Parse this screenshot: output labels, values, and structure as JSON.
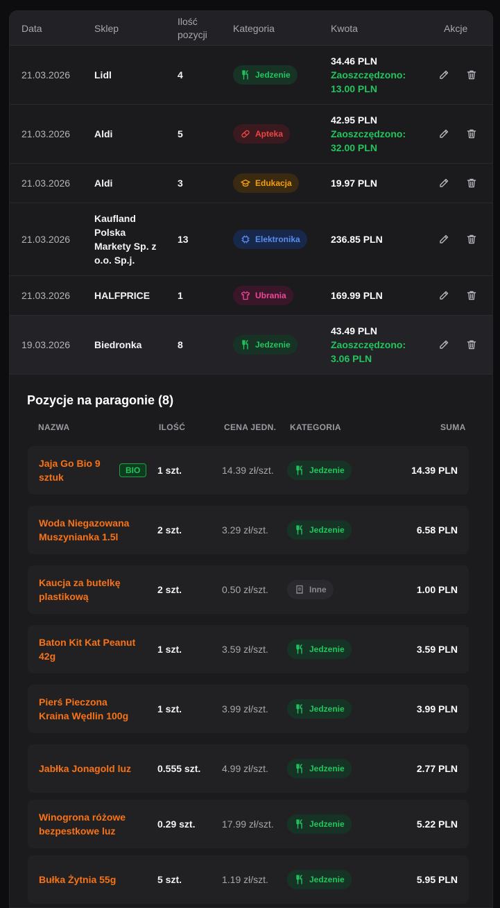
{
  "table": {
    "headers": {
      "date": "Data",
      "shop": "Sklep",
      "count_line1": "Ilość",
      "count_line2": "pozycji",
      "category": "Kategoria",
      "amount": "Kwota",
      "actions": "Akcje"
    },
    "rows": [
      {
        "date": "21.03.2026",
        "shop": "Lidl",
        "count": "4",
        "category": "Jedzenie",
        "amount": "34.46 PLN",
        "saved_label": "Zaoszczędzono:",
        "saved_value": "13.00 PLN"
      },
      {
        "date": "21.03.2026",
        "shop": "Aldi",
        "count": "5",
        "category": "Apteka",
        "amount": "42.95 PLN",
        "saved_label": "Zaoszczędzono:",
        "saved_value": "32.00 PLN"
      },
      {
        "date": "21.03.2026",
        "shop": "Aldi",
        "count": "3",
        "category": "Edukacja",
        "amount": "19.97 PLN"
      },
      {
        "date": "21.03.2026",
        "shop": "Kaufland Polska Markety Sp. z o.o. Sp.j.",
        "count": "13",
        "category": "Elektronika",
        "amount": "236.85 PLN"
      },
      {
        "date": "21.03.2026",
        "shop": "HALFPRICE",
        "count": "1",
        "category": "Ubrania",
        "amount": "169.99 PLN"
      },
      {
        "date": "19.03.2026",
        "shop": "Biedronka",
        "count": "8",
        "category": "Jedzenie",
        "amount": "43.49 PLN",
        "saved_label": "Zaoszczędzono:",
        "saved_value": "3.06 PLN"
      }
    ]
  },
  "detail": {
    "title": "Pozycje na paragonie (8)",
    "headers": {
      "name": "NAZWA",
      "qty": "ILOŚĆ",
      "unit_price": "CENA JEDN.",
      "category": "KATEGORIA",
      "sum": "SUMA"
    },
    "bio_label": "BIO",
    "items": [
      {
        "name": "Jaja Go Bio 9 sztuk",
        "qty": "1 szt.",
        "unit_price": "14.39 zł/szt.",
        "category": "Jedzenie",
        "sum": "14.39 PLN"
      },
      {
        "name": "Woda Niegazowana Muszynianka 1.5l",
        "qty": "2 szt.",
        "unit_price": "3.29 zł/szt.",
        "category": "Jedzenie",
        "sum": "6.58 PLN"
      },
      {
        "name": "Kaucja za butelkę plastikową",
        "qty": "2 szt.",
        "unit_price": "0.50 zł/szt.",
        "category": "Inne",
        "sum": "1.00 PLN"
      },
      {
        "name": "Baton Kit Kat Peanut 42g",
        "qty": "1 szt.",
        "unit_price": "3.59 zł/szt.",
        "category": "Jedzenie",
        "sum": "3.59 PLN"
      },
      {
        "name": "Pierś Pieczona Kraina Wędlin 100g",
        "qty": "1 szt.",
        "unit_price": "3.99 zł/szt.",
        "category": "Jedzenie",
        "sum": "3.99 PLN"
      },
      {
        "name": "Jabłka Jonagold luz",
        "qty": "0.555 szt.",
        "unit_price": "4.99 zł/szt.",
        "category": "Jedzenie",
        "sum": "2.77 PLN"
      },
      {
        "name": "Winogrona różowe bezpestkowe luz",
        "qty": "0.29 szt.",
        "unit_price": "17.99 zł/szt.",
        "category": "Jedzenie",
        "sum": "5.22 PLN"
      },
      {
        "name": "Bułka Żytnia 55g",
        "qty": "5 szt.",
        "unit_price": "1.19 zł/szt.",
        "category": "Jedzenie",
        "sum": "5.95 PLN"
      }
    ]
  },
  "icons": {
    "food": "fork-knife-icon",
    "pharmacy": "pill-icon",
    "education": "graduation-cap-icon",
    "electronics": "chip-icon",
    "clothing": "shirt-icon",
    "other": "receipt-icon",
    "edit": "pencil-icon",
    "delete": "trash-icon"
  },
  "colors": {
    "accent_orange": "#f97316",
    "saved_green": "#22c55e",
    "food": "#22c55e",
    "pharmacy": "#ef4444",
    "education": "#f59e0b",
    "electronics": "#5b8def",
    "clothing": "#ec4899",
    "other": "#8a8a90"
  }
}
